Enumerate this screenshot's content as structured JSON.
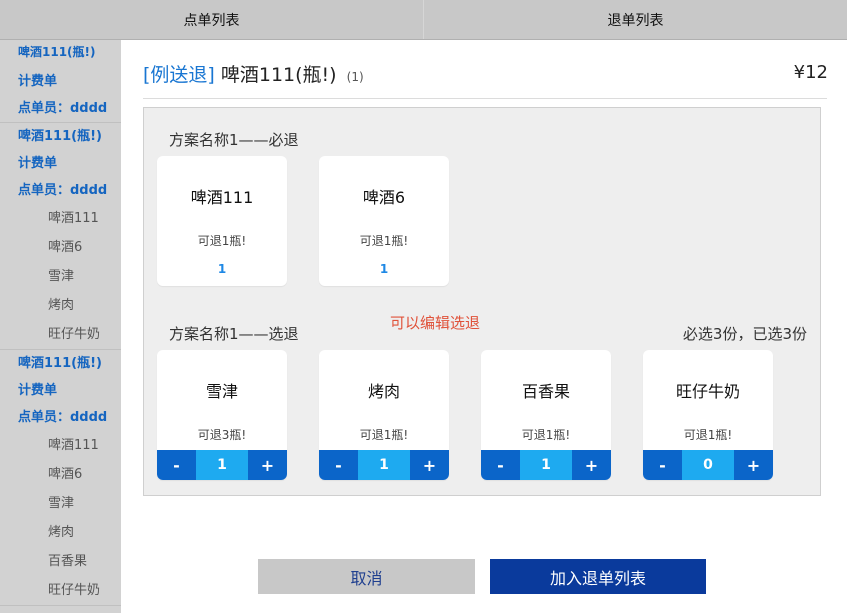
{
  "tabs": {
    "order_list": "点单列表",
    "return_list": "退单列表"
  },
  "sidebar": {
    "groups": [
      {
        "title": "啤酒111(瓶!)",
        "bill": "计费单",
        "staff": "点单员：dddd",
        "items": []
      },
      {
        "title": "啤酒111(瓶!)",
        "bill": "计费单",
        "staff": "点单员：dddd",
        "items": [
          "啤酒111",
          "啤酒6",
          "雪津",
          "烤肉",
          "旺仔牛奶"
        ]
      },
      {
        "title": "啤酒111(瓶!)",
        "bill": "计费单",
        "staff": "点单员：dddd",
        "items": [
          "啤酒111",
          "啤酒6",
          "雪津",
          "烤肉",
          "百香果",
          "旺仔牛奶"
        ]
      }
    ]
  },
  "dialog": {
    "tag": "[例送退]",
    "name": "啤酒111(瓶!)",
    "count": "(1)",
    "price": "¥12",
    "required_title": "方案名称1——必退",
    "required_items": [
      {
        "name": "啤酒111",
        "avail": "可退1瓶!",
        "qty": "1"
      },
      {
        "name": "啤酒6",
        "avail": "可退1瓶!",
        "qty": "1"
      }
    ],
    "optional_title": "方案名称1——选退",
    "edit_hint": "可以编辑选退",
    "select_info": "必选3份，已选3份",
    "optional_items": [
      {
        "name": "雪津",
        "avail": "可退3瓶!",
        "qty": "1"
      },
      {
        "name": "烤肉",
        "avail": "可退1瓶!",
        "qty": "1"
      },
      {
        "name": "百香果",
        "avail": "可退1瓶!",
        "qty": "1"
      },
      {
        "name": "旺仔牛奶",
        "avail": "可退1瓶!",
        "qty": "0"
      }
    ],
    "stepper": {
      "minus": "-",
      "plus": "+"
    },
    "cancel": "取消",
    "add": "加入退单列表"
  },
  "colors": {
    "accent": "#1976d2",
    "primary_button": "#0a3a9c",
    "stepper_button": "#0b65c9",
    "stepper_value": "#1eaaf0",
    "hint": "#e0523a"
  }
}
